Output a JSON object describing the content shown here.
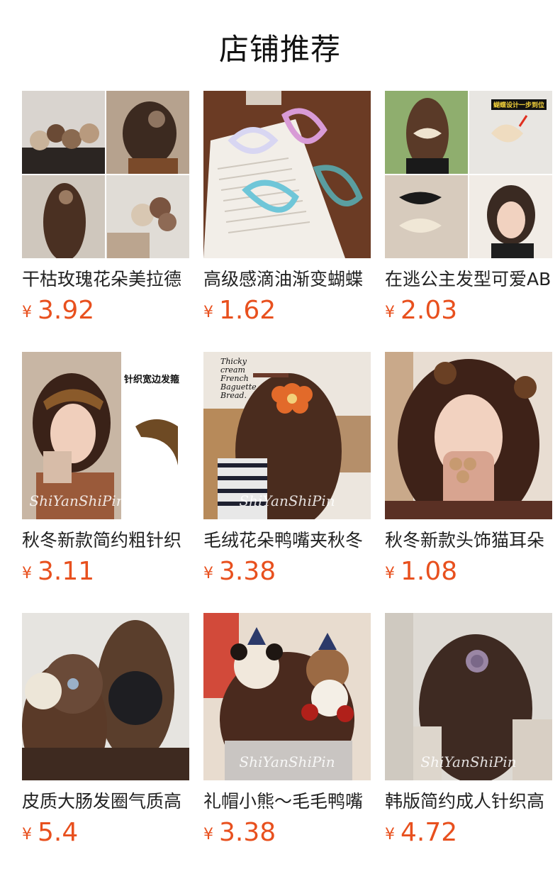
{
  "header": {
    "title": "店铺推荐"
  },
  "products": [
    {
      "name": "干枯玫瑰花朵美拉德",
      "currency": "¥",
      "price": "3.92",
      "image_icon": "rose-hairclip-photo"
    },
    {
      "name": "高级感滴油渐变蝴蝶",
      "currency": "¥",
      "price": "1.62",
      "image_icon": "butterfly-clip-photo"
    },
    {
      "name": "在逃公主发型可爱AB",
      "currency": "¥",
      "price": "2.03",
      "image_icon": "bow-hairclip-photo",
      "banner": "蝴蝶设计一步到位"
    },
    {
      "name": "秋冬新款简约粗针织",
      "currency": "¥",
      "price": "3.11",
      "image_icon": "knit-headband-photo",
      "banner": "针织宽边发箍",
      "watermark": "ShiYanShiPin"
    },
    {
      "name": "毛绒花朵鸭嘴夹秋冬",
      "currency": "¥",
      "price": "3.38",
      "image_icon": "flower-duckbill-clip-photo",
      "watermark": "ShiYanShiPin",
      "poster": "Thicky cream French Baguette Bread."
    },
    {
      "name": "秋冬新款头饰猫耳朵",
      "currency": "¥",
      "price": "1.08",
      "image_icon": "bear-ear-clip-photo"
    },
    {
      "name": "皮质大肠发圈气质高",
      "currency": "¥",
      "price": "5.4",
      "image_icon": "scrunchie-photo"
    },
    {
      "name": "礼帽小熊～毛毛鸭嘴",
      "currency": "¥",
      "price": "3.38",
      "image_icon": "bear-clip-photo",
      "watermark": "ShiYanShiPin"
    },
    {
      "name": "韩版简约成人针织高",
      "currency": "¥",
      "price": "4.72",
      "image_icon": "rose-claw-photo",
      "watermark": "ShiYanShiPin"
    }
  ],
  "colors": {
    "price": "#e8501e",
    "title": "#111111",
    "text": "#222222"
  }
}
